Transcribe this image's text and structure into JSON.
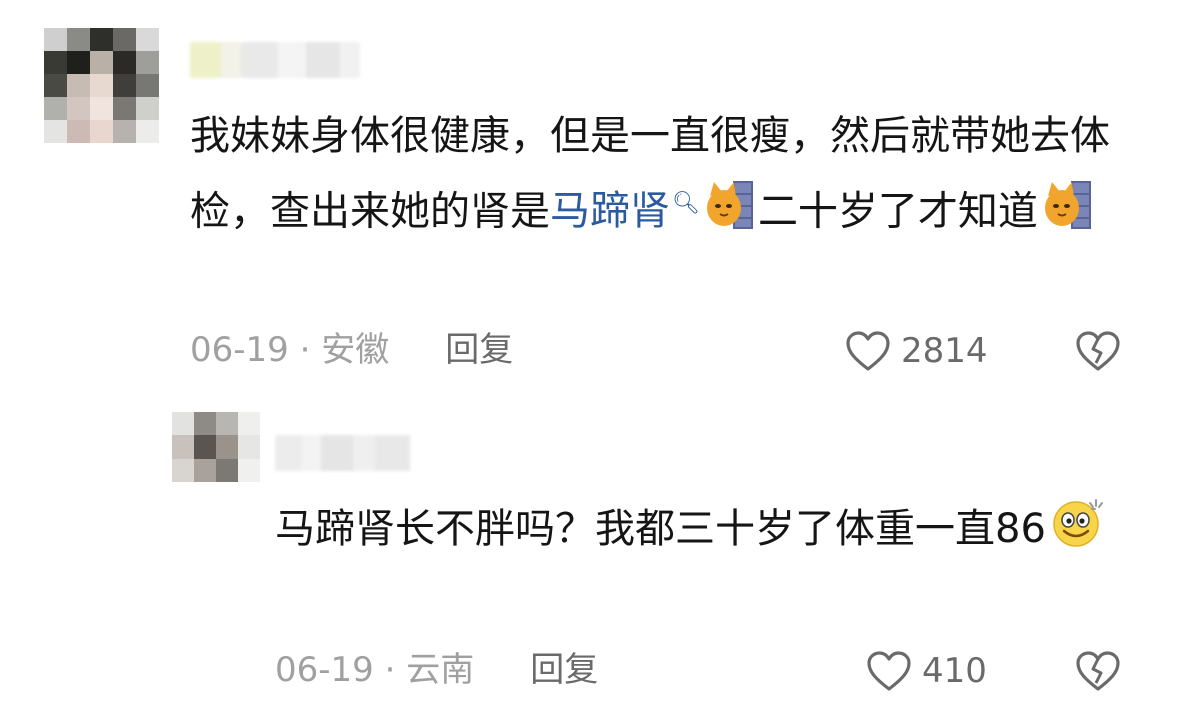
{
  "comments": [
    {
      "text_before_link": "我妹妹身体很健康，但是一直很瘦，然后就带她去体检，查出来她的肾是",
      "link_text": "马蹄肾",
      "text_after_link": "二十岁了才知道",
      "date_location": "06-19 · 安徽",
      "reply_label": "回复",
      "likes": "2814"
    },
    {
      "text_main": "马蹄肾长不胖吗？我都三十岁了体重一直86",
      "date_location": "06-19 · 云南",
      "reply_label": "回复",
      "likes": "410"
    }
  ],
  "icons": {
    "search": "search-icon",
    "cat_emoji": "cat-peeking-emoji",
    "smile_emoji": "dazzled-smile-emoji",
    "like": "heart-icon",
    "dislike": "broken-heart-icon"
  },
  "colors": {
    "link": "#2b5b9e",
    "meta": "#a0a0a0",
    "text": "#151515"
  }
}
